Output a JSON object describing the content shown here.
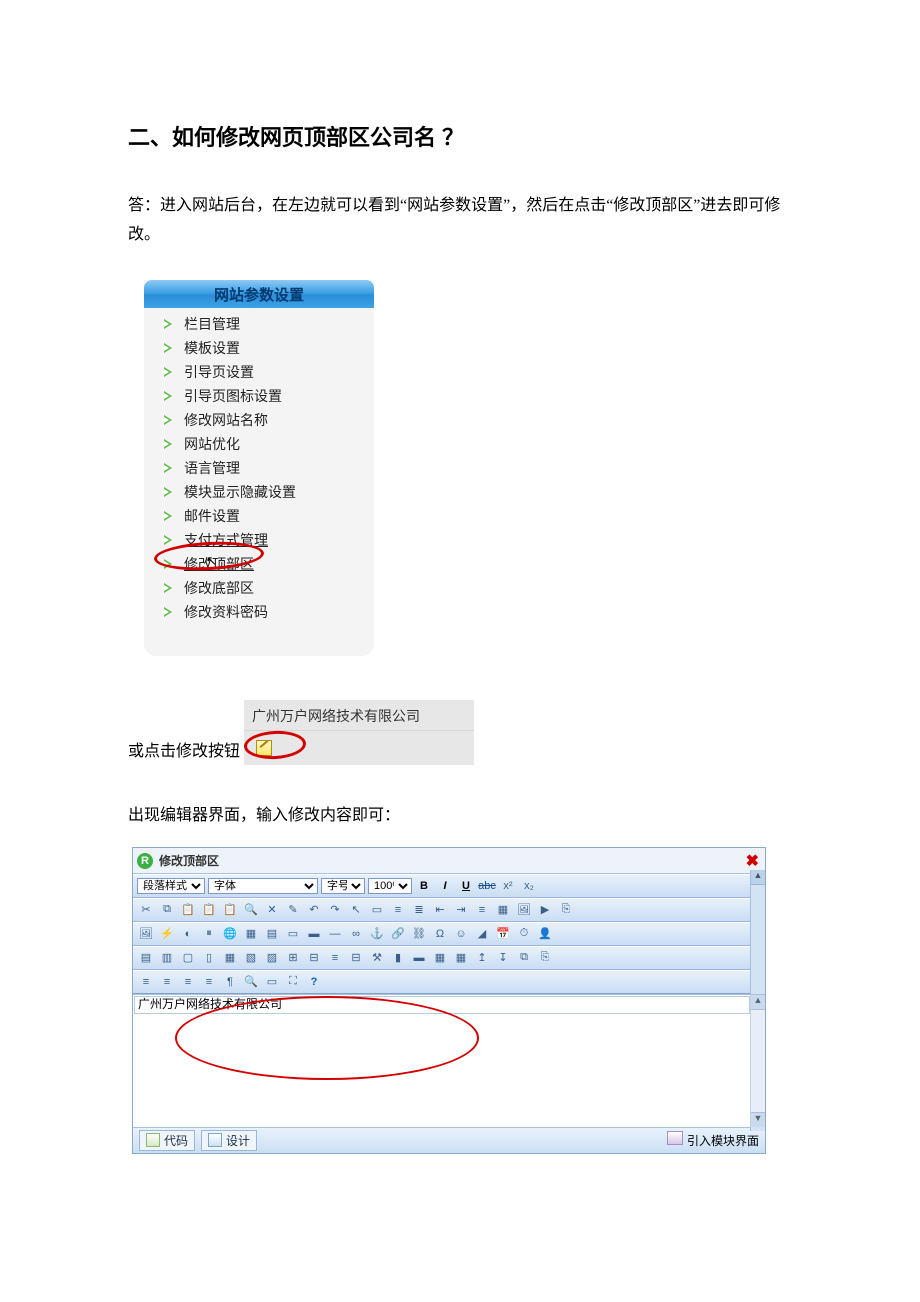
{
  "heading": "二、如何修改网页顶部区公司名 ？",
  "answer": "答：进入网站后台，在左边就可以看到“网站参数设置”，然后在点击“修改顶部区”进去即可修改。",
  "sidebar": {
    "title": "网站参数设置",
    "items": [
      {
        "label": "栏目管理"
      },
      {
        "label": "模板设置"
      },
      {
        "label": "引导页设置"
      },
      {
        "label": "引导页图标设置"
      },
      {
        "label": "修改网站名称"
      },
      {
        "label": "网站优化"
      },
      {
        "label": "语言管理"
      },
      {
        "label": "模块显示隐藏设置"
      },
      {
        "label": "邮件设置"
      },
      {
        "label": "支付方式管理",
        "under": true
      },
      {
        "label": "修改顶部区",
        "under": true,
        "highlight": true
      },
      {
        "label": "修改底部区"
      },
      {
        "label": "修改资料密码"
      }
    ]
  },
  "small_bar": {
    "leading_text": "或点击修改按钮",
    "company": "广州万户网络技术有限公司"
  },
  "between": "出现编辑器界面，输入修改内容即可：",
  "editor": {
    "title": "修改顶部区",
    "dropdowns": {
      "paragraph": "段落样式",
      "font": "字体",
      "size": "字号",
      "zoom": "100%"
    },
    "content": "广州万户网络技术有限公司",
    "footer": {
      "code": "代码",
      "design": "设计",
      "import": "引入模块界面"
    }
  }
}
